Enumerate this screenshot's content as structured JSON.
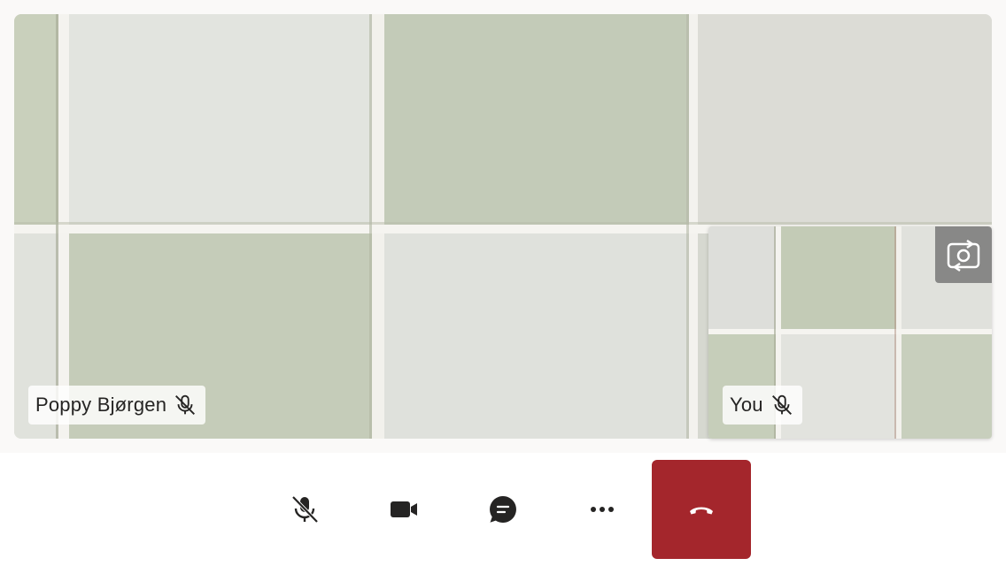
{
  "remote_participant": {
    "name": "Poppy Bjørgen",
    "muted_icon": "mic-off-icon"
  },
  "local_participant": {
    "name": "You",
    "muted_icon": "mic-off-icon",
    "switch_camera_icon": "switch-camera-icon"
  },
  "controls": {
    "microphone": {
      "icon": "mic-off-icon",
      "state": "muted"
    },
    "camera": {
      "icon": "video-camera-icon",
      "state": "on"
    },
    "chat": {
      "icon": "chat-icon"
    },
    "more": {
      "icon": "more-options-icon"
    },
    "end_call": {
      "icon": "hang-up-icon",
      "color": "#a4262c"
    }
  },
  "colors": {
    "end_call": "#a4262c",
    "control_icon": "#252423",
    "background": "#faf9f8"
  }
}
